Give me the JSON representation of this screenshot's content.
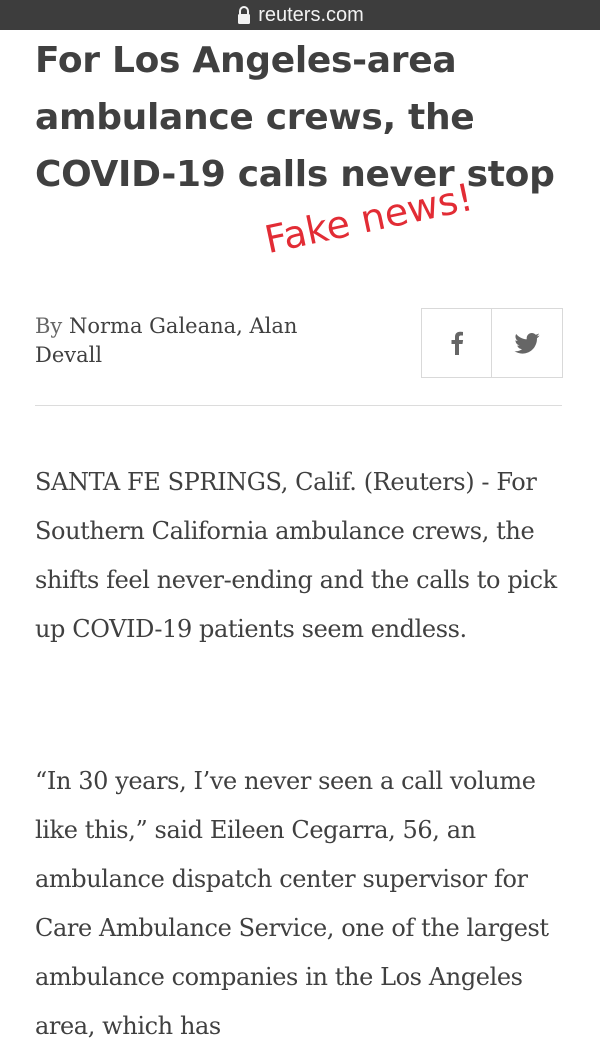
{
  "browser": {
    "url": "reuters.com",
    "lock_icon": "lock-icon"
  },
  "article": {
    "headline": "For Los Angeles-area ambulance crews, the COVID-19 calls never stop",
    "byline_prefix": "By",
    "byline_authors": "Norma Galeana, Alan Devall",
    "share": {
      "facebook_icon": "facebook-icon",
      "twitter_icon": "twitter-icon"
    },
    "paragraphs": [
      "SANTA FE SPRINGS, Calif. (Reuters) - For Southern California ambulance crews, the shifts feel never-ending and the calls to pick up COVID-19 patients seem endless.",
      "“In 30 years, I’ve never seen a call volume like this,” said Eileen Cegarra, 56, an ambulance dispatch center supervisor for Care Ambulance Service, one of the largest ambulance companies in the Los Angeles area, which has"
    ]
  },
  "annotation": {
    "text": "Fake news!",
    "color": "#e22c35"
  },
  "colors": {
    "url_bar": "#3d3d3d",
    "text": "#404040",
    "border": "#d9d9d9"
  }
}
